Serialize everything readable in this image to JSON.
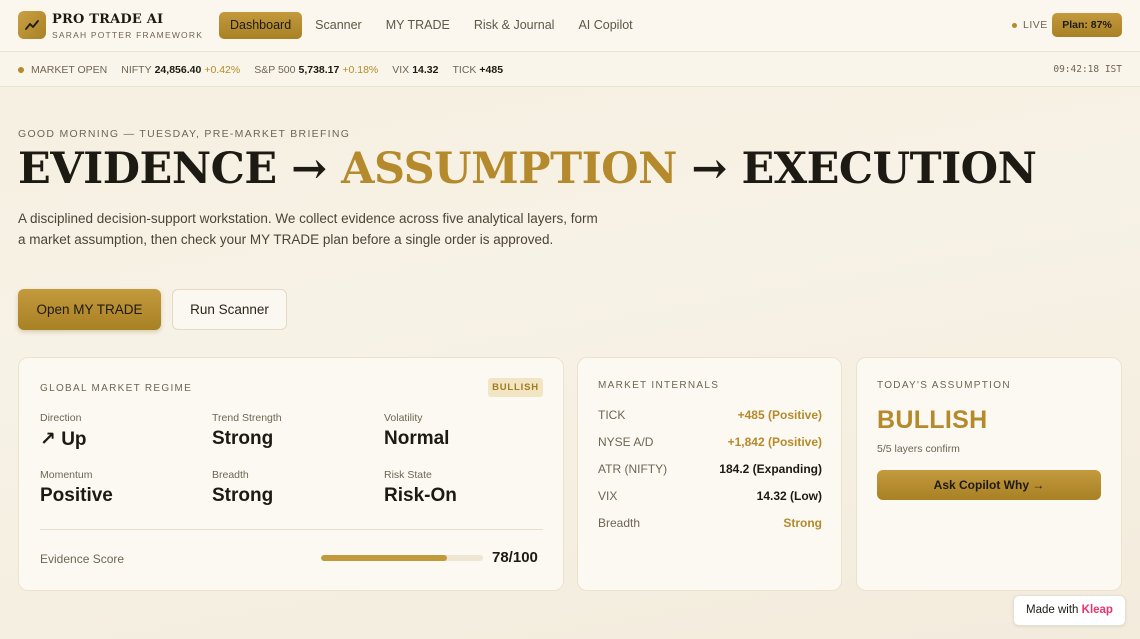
{
  "brand": {
    "title": "PRO TRADE AI",
    "subtitle": "SARAH POTTER FRAMEWORK",
    "icon": "trend-up-icon"
  },
  "nav": {
    "items": [
      {
        "label": "Dashboard",
        "active": true
      },
      {
        "label": "Scanner"
      },
      {
        "label": "MY TRADE"
      },
      {
        "label": "Risk & Journal"
      },
      {
        "label": "AI Copilot"
      }
    ],
    "live_label": "LIVE",
    "plan_label": "Plan: 87%"
  },
  "ticker": {
    "status": "MARKET OPEN",
    "items": [
      {
        "name": "NIFTY",
        "value": "24,856.40",
        "change": "+0.42%"
      },
      {
        "name": "S&P 500",
        "value": "5,738.17",
        "change": "+0.18%"
      },
      {
        "name": "VIX",
        "value": "14.32",
        "change": ""
      },
      {
        "name": "TICK",
        "value": "+485",
        "change": ""
      }
    ],
    "time": "09:42:18 IST"
  },
  "hero": {
    "greeting": "GOOD MORNING — TUESDAY, PRE-MARKET BRIEFING",
    "headline": {
      "part1": "EVIDENCE",
      "arrow1": " → ",
      "part2": "ASSUMPTION",
      "arrow2": " → ",
      "part3": "EXECUTION"
    },
    "intro": "A disciplined decision-support workstation. We collect evidence across five analytical layers, form a market assumption, then check your MY TRADE plan before a single order is approved.",
    "primary_button": "Open MY TRADE",
    "secondary_button": "Run Scanner"
  },
  "regime": {
    "label": "GLOBAL MARKET REGIME",
    "badge": "BULLISH",
    "metrics": [
      {
        "label": "Direction",
        "value": "↗ Up"
      },
      {
        "label": "Trend Strength",
        "value": "Strong"
      },
      {
        "label": "Volatility",
        "value": "Normal"
      },
      {
        "label": "Momentum",
        "value": "Positive"
      },
      {
        "label": "Breadth",
        "value": "Strong"
      },
      {
        "label": "Risk State",
        "value": "Risk-On"
      }
    ],
    "evidence_label": "Evidence Score",
    "evidence_score": "78/100",
    "evidence_fraction": 0.78
  },
  "internals": {
    "label": "MARKET INTERNALS",
    "rows": [
      {
        "name": "TICK",
        "value": "+485 (Positive)",
        "style": "gold"
      },
      {
        "name": "NYSE A/D",
        "value": "+1,842 (Positive)",
        "style": "gold"
      },
      {
        "name": "ATR (NIFTY)",
        "value": "184.2 (Expanding)",
        "style": "dark"
      },
      {
        "name": "VIX",
        "value": "14.32 (Low)",
        "style": "dark"
      },
      {
        "name": "Breadth",
        "value": "Strong",
        "style": "gold"
      }
    ]
  },
  "assumption": {
    "label": "TODAY'S ASSUMPTION",
    "value": "BULLISH",
    "sub": "5/5 layers confirm",
    "button": "Ask Copilot Why →"
  },
  "footer": {
    "made_with": "Made with",
    "brand": "Kleap"
  },
  "colors": {
    "accent": "#b48a2c",
    "background": "#f7f2e6",
    "text": "#1d1a14"
  }
}
